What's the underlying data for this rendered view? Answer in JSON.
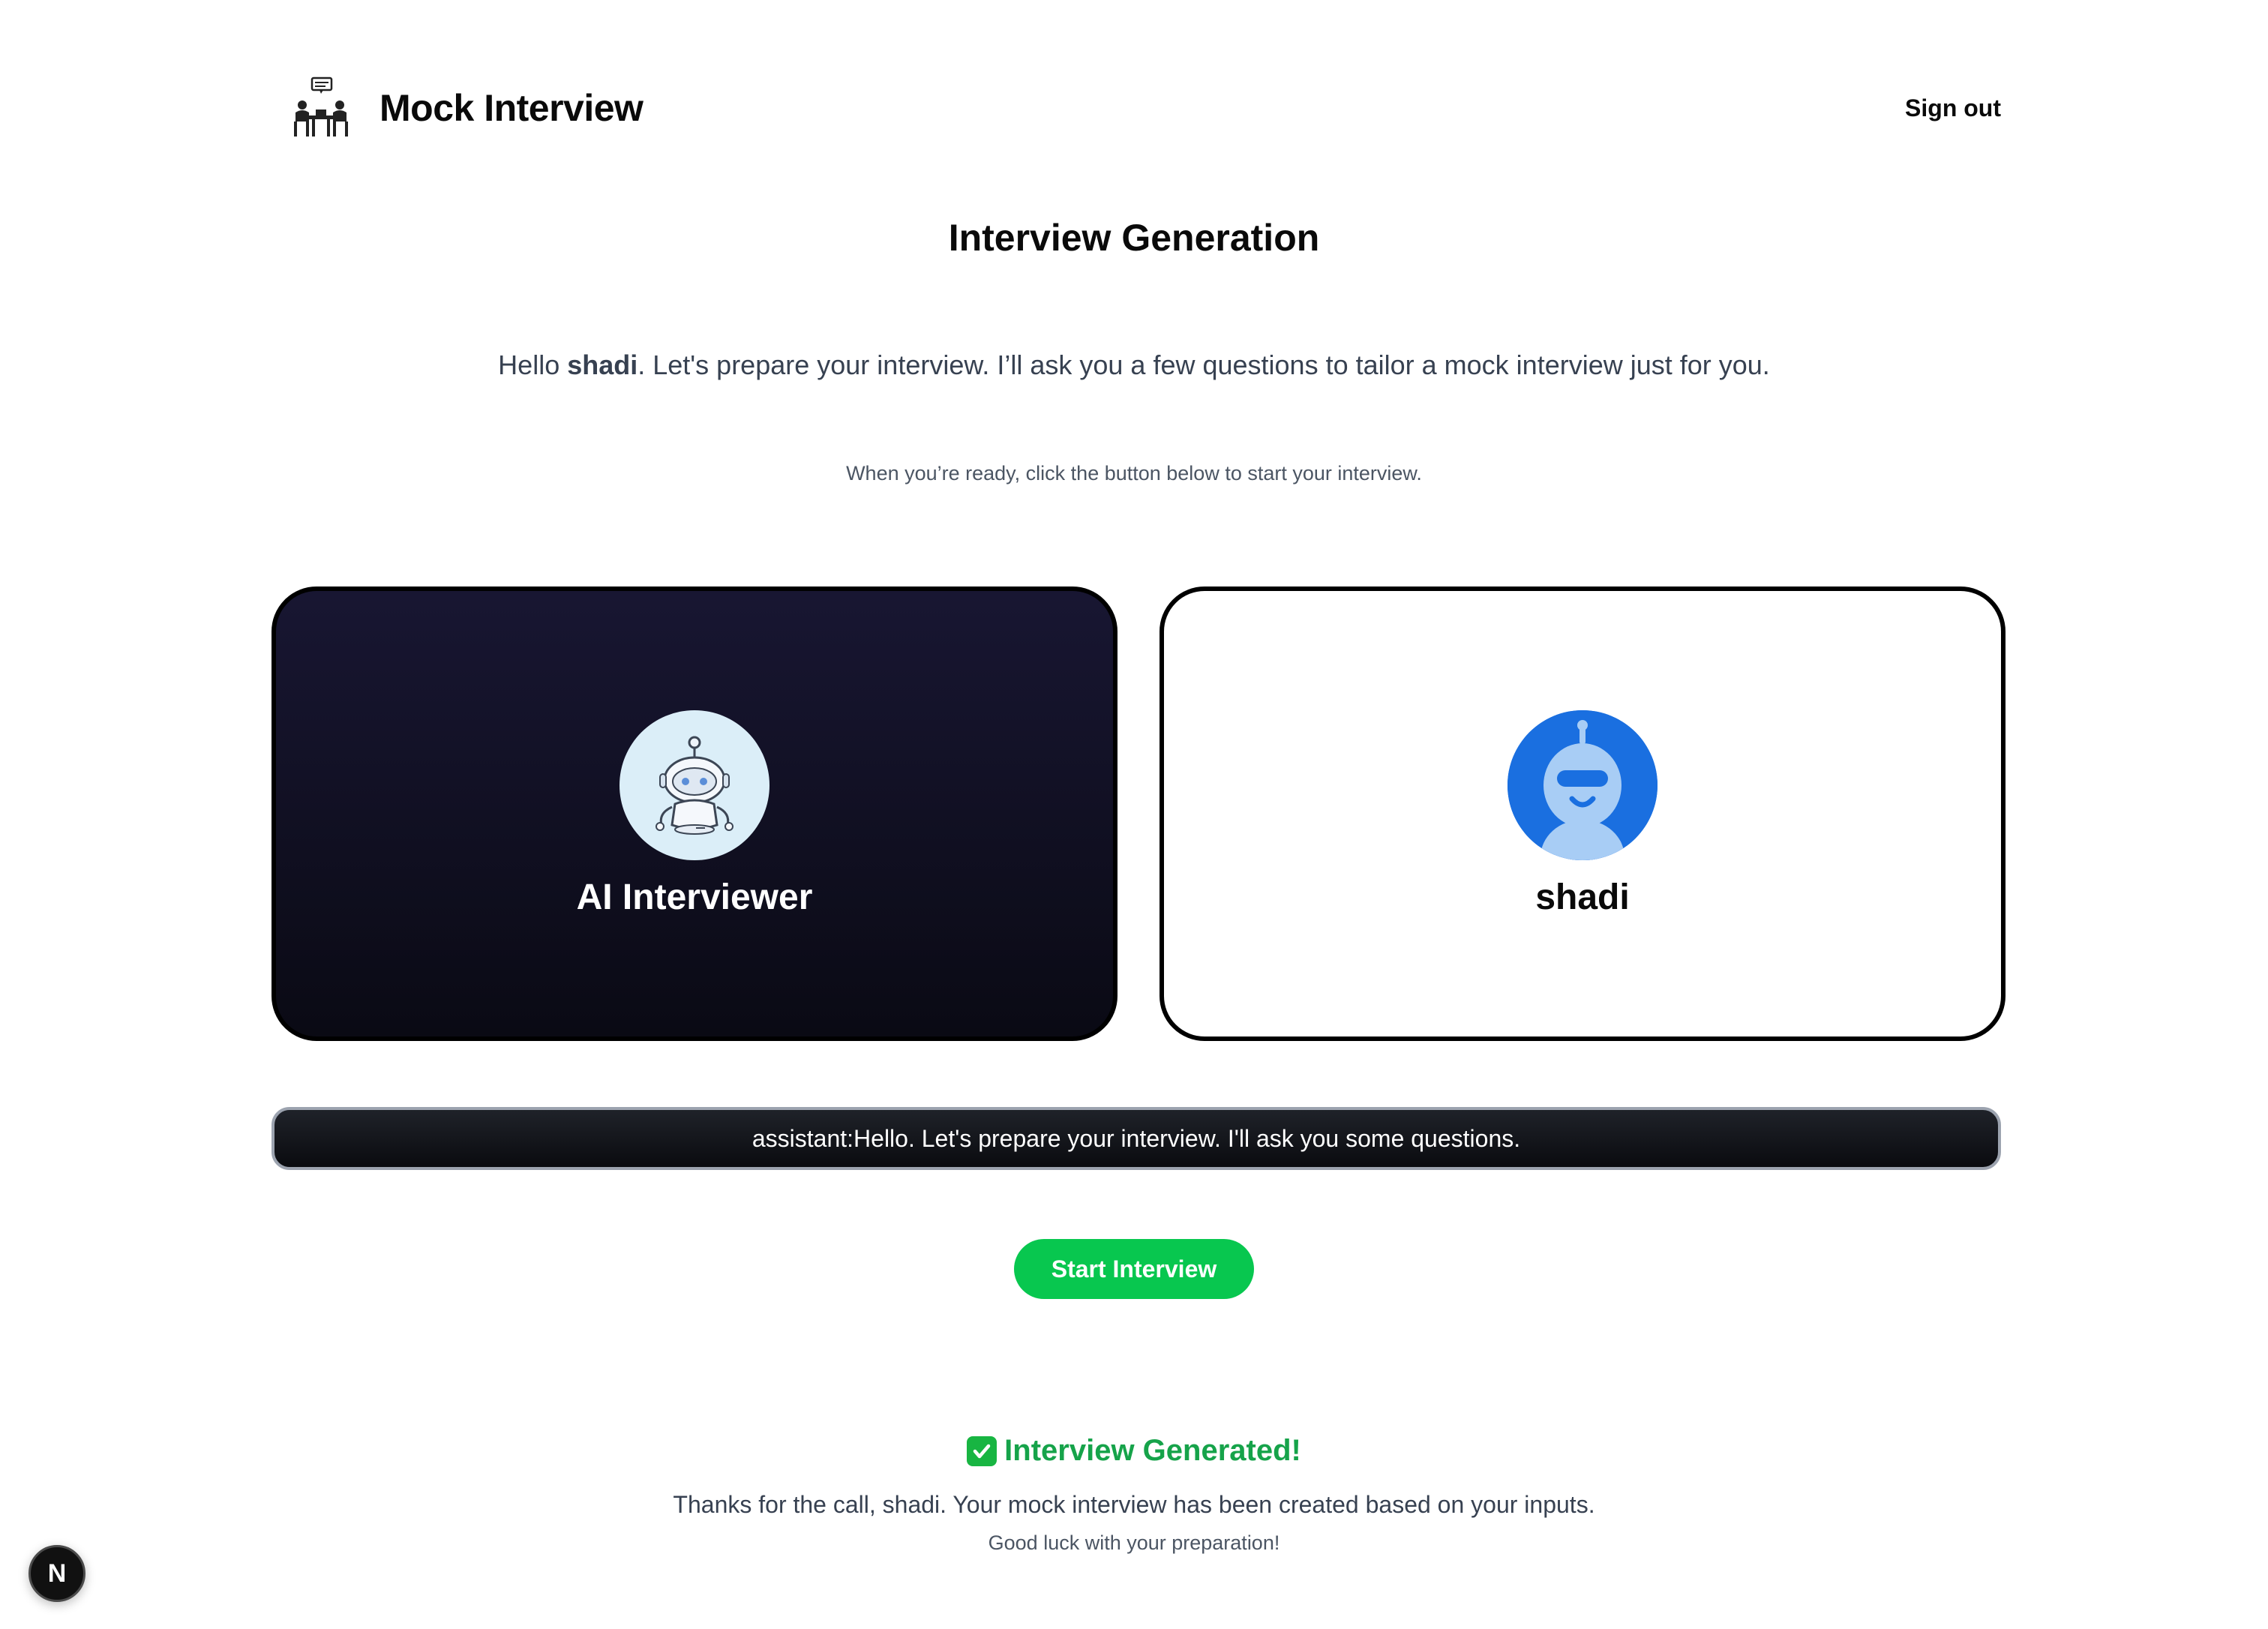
{
  "header": {
    "brand_name": "Mock Interview",
    "logo_icon": "interview-table-icon",
    "signout_label": "Sign out"
  },
  "main": {
    "title": "Interview Generation",
    "intro_prefix": "Hello ",
    "intro_username": "shadi",
    "intro_suffix": ". Let's prepare your interview. I’ll ask you a few questions to tailor a mock interview just for you.",
    "hint": "When you’re ready, click the button below to start your interview."
  },
  "cards": {
    "ai": {
      "name": "AI Interviewer",
      "avatar_icon": "robot-avatar-icon"
    },
    "user": {
      "name": "shadi",
      "avatar_icon": "user-robot-avatar-icon"
    }
  },
  "transcript": {
    "text": "assistant:Hello. Let's prepare your interview. I'll ask you some questions."
  },
  "start_button": {
    "label": "Start Interview",
    "color": "#08c74f"
  },
  "success": {
    "title": "Interview Generated!",
    "icon": "check-mark-icon",
    "message": "Thanks for the call, shadi. Your mock interview has been created based on your inputs.",
    "sub": "Good luck with your preparation!",
    "color": "#16a34a"
  },
  "dev_badge": {
    "letter": "N"
  }
}
